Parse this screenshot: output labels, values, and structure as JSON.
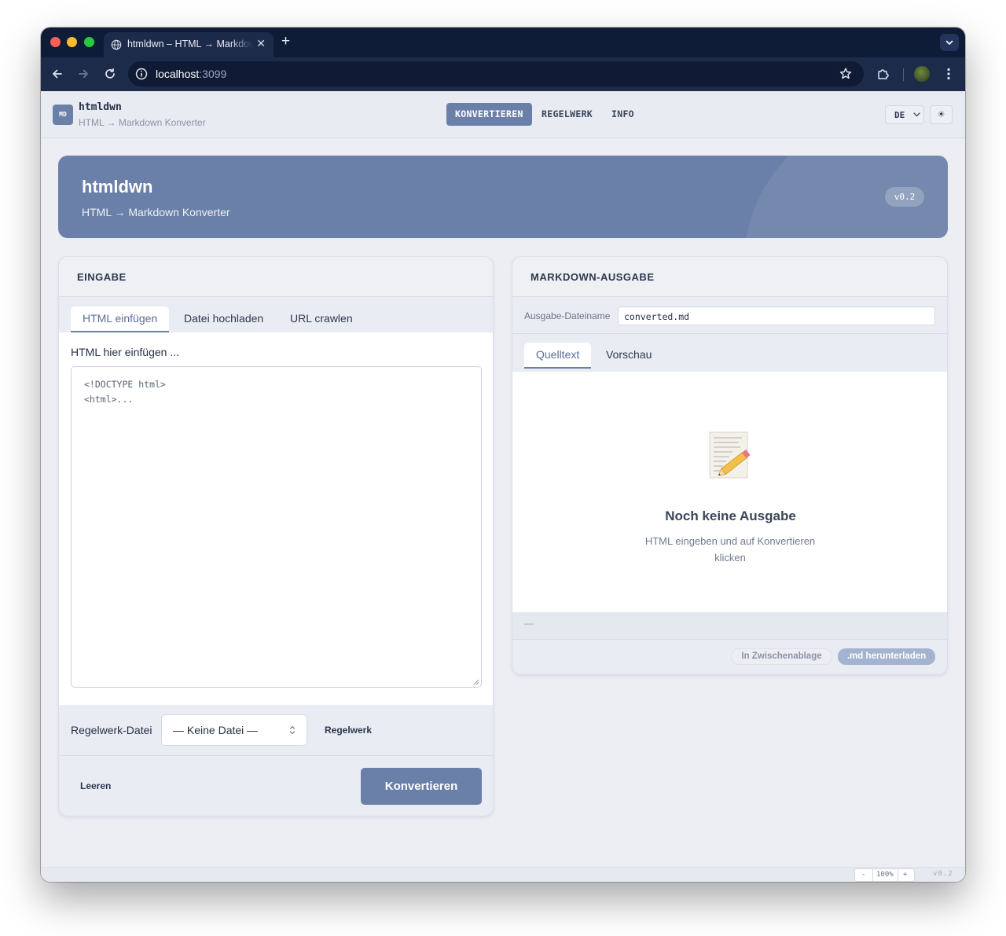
{
  "browser": {
    "tab_title": "htmldwn – HTML → Markdown Konverter",
    "url_host": "localhost",
    "url_port": ":3099"
  },
  "app": {
    "logo_text": "MD",
    "brand_name": "htmldwn",
    "brand_subtitle": "HTML → Markdown Konverter",
    "nav": [
      "KONVERTIEREN",
      "REGELWERK",
      "INFO"
    ],
    "language": "DE",
    "theme_icon": "☀"
  },
  "hero": {
    "title": "htmldwn",
    "subtitle": "HTML → Markdown Konverter",
    "version": "v0.2"
  },
  "input_panel": {
    "header": "EINGABE",
    "tabs": [
      "HTML einfügen",
      "Datei hochladen",
      "URL crawlen"
    ],
    "active_tab": "HTML einfügen",
    "field_label": "HTML hier einfügen ...",
    "textarea_placeholder": "<!DOCTYPE html>\n<html>...",
    "rules_label": "Regelwerk-Datei",
    "rules_select_value": "— Keine Datei —",
    "rules_link": "Regelwerk",
    "clear_button": "Leeren",
    "convert_button": "Konvertieren"
  },
  "output_panel": {
    "header": "MARKDOWN-AUSGABE",
    "filename_label": "Ausgabe-Dateiname",
    "filename_value": "converted.md",
    "tabs": [
      "Quelltext",
      "Vorschau"
    ],
    "active_tab": "Quelltext",
    "empty_title": "Noch keine Ausgabe",
    "empty_subtitle": "HTML eingeben und auf Konvertieren klicken",
    "status_text": "—",
    "copy_button": "In Zwischenablage",
    "download_button": ".md herunterladen"
  },
  "footer": {
    "zoom_minus": "-",
    "zoom_level": "100%",
    "zoom_plus": "+",
    "version": "v0.2"
  },
  "colors": {
    "accent": "#6b80a8",
    "browser_chrome": "#1d2b4a",
    "app_background": "#eceef3"
  }
}
